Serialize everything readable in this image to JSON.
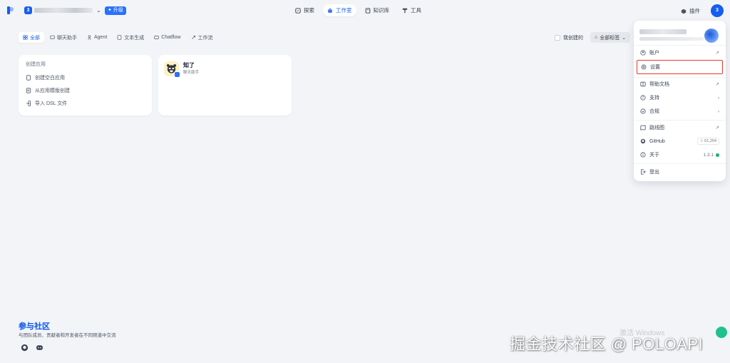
{
  "header": {
    "workspace_initial": "3",
    "upgrade_label": "升级",
    "tabs": [
      {
        "label": "探索",
        "icon": "compass-icon"
      },
      {
        "label": "工作室",
        "icon": "robot-icon",
        "active": true
      },
      {
        "label": "知识库",
        "icon": "book-icon"
      },
      {
        "label": "工具",
        "icon": "hammer-icon"
      }
    ],
    "plugin_label": "插件",
    "avatar_initial": "3"
  },
  "filters": {
    "tabs": [
      {
        "label": "全部",
        "active": true
      },
      {
        "label": "聊天助手"
      },
      {
        "label": "Agent"
      },
      {
        "label": "文本生成"
      },
      {
        "label": "Chatflow"
      },
      {
        "label": "工作流"
      }
    ],
    "mine_label": "我创建的",
    "tags_label": "全部标签"
  },
  "create_card": {
    "title": "创建应用",
    "items": [
      "创建空白应用",
      "从应用模版创建",
      "导入 DSL 文件"
    ]
  },
  "app_card": {
    "name": "知了",
    "type": "聊天助手"
  },
  "menu": {
    "items": [
      {
        "label": "账户",
        "right": "↗"
      },
      {
        "label": "设置",
        "highlighted": true
      },
      {
        "label": "帮助文档",
        "right": "↗"
      },
      {
        "label": "支持",
        "right": "›"
      },
      {
        "label": "合规",
        "right": "›"
      },
      {
        "label": "路线图",
        "right": "↗"
      },
      {
        "label": "GitHub",
        "stars": "☆ 61,204"
      },
      {
        "label": "关于",
        "version": "1.3.1"
      },
      {
        "label": "登出"
      }
    ]
  },
  "community": {
    "title": "参与社区",
    "desc": "与团队成员、贡献者和开发者在不同频道中交流"
  },
  "overlay": {
    "windows_activate": "激活 Windows",
    "watermark": "掘金技术社区 @ POLOAPI"
  },
  "colors": {
    "accent": "#155eef",
    "highlight_border": "#e5392c",
    "background": "#f2f4f7"
  }
}
